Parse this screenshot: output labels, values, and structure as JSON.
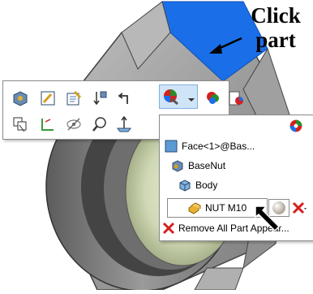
{
  "callout": {
    "line1": "Click",
    "line2": "part"
  },
  "toolbar": {
    "row1": [
      "appearance-cube-icon",
      "edit-sketch-icon",
      "edit-part-icon",
      "sort-order-icon",
      "return-arrow-icon",
      "appearance-color-icon",
      "dropdown-arrow-icon",
      "appearance-ball-icon",
      "appearance-doc-icon"
    ],
    "row2": [
      "hide-show-icon",
      "sketch-plane-icon",
      "hide-eye-icon",
      "zoom-selection-icon",
      "normal-to-icon"
    ]
  },
  "menu": {
    "items": [
      {
        "label": "Face<1>@Bas...",
        "icon": "face-icon"
      },
      {
        "label": "BaseNut",
        "icon": "part-icon"
      },
      {
        "label": "Body",
        "icon": "body-icon"
      },
      {
        "label": "NUT M10",
        "icon": "feature-icon"
      }
    ],
    "remove_label": "Remove All Part Appear..."
  },
  "colors": {
    "part_blue": "#1a6fe8",
    "part_gray": "#8a8a8a",
    "menu_border": "#8a8a8a",
    "remove_red": "#d42020"
  }
}
